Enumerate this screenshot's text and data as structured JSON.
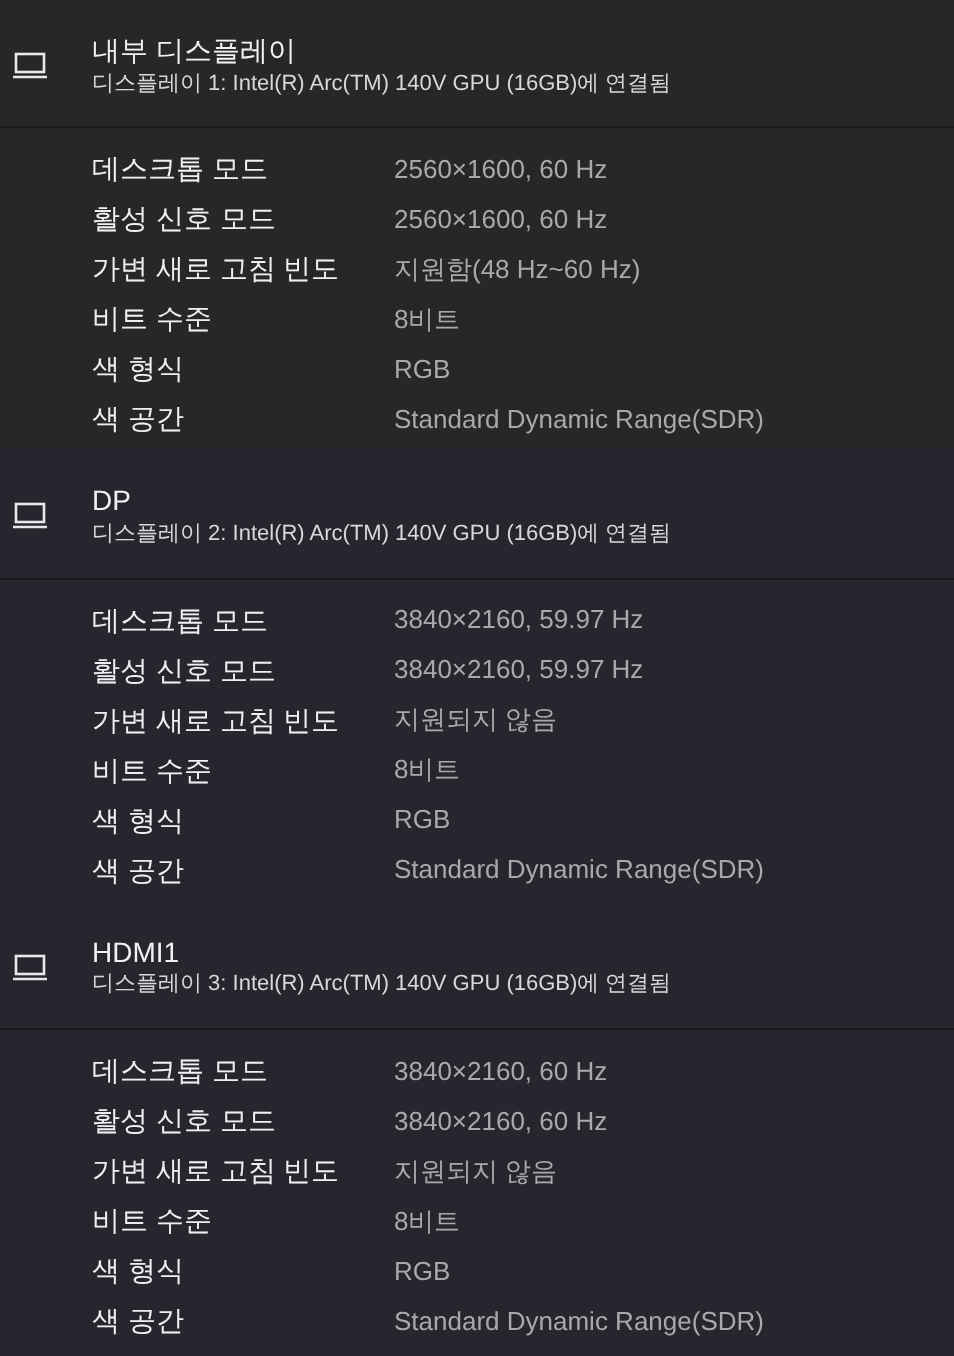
{
  "displays": [
    {
      "name": "내부 디스플레이",
      "connection": "디스플레이 1: Intel(R) Arc(TM) 140V GPU (16GB)에 연결됨",
      "properties": [
        {
          "label": "데스크톱 모드",
          "value": "2560×1600, 60 Hz"
        },
        {
          "label": "활성 신호 모드",
          "value": "2560×1600, 60 Hz"
        },
        {
          "label": "가변 새로 고침 빈도",
          "value": "지원함(48 Hz~60 Hz)"
        },
        {
          "label": "비트 수준",
          "value": "8비트"
        },
        {
          "label": "색 형식",
          "value": "RGB"
        },
        {
          "label": "색 공간",
          "value": "Standard Dynamic Range(SDR)"
        }
      ]
    },
    {
      "name": "DP",
      "connection": "디스플레이 2: Intel(R) Arc(TM) 140V GPU (16GB)에 연결됨",
      "properties": [
        {
          "label": "데스크톱 모드",
          "value": "3840×2160, 59.97 Hz"
        },
        {
          "label": "활성 신호 모드",
          "value": "3840×2160, 59.97 Hz"
        },
        {
          "label": "가변 새로 고침 빈도",
          "value": "지원되지 않음"
        },
        {
          "label": "비트 수준",
          "value": "8비트"
        },
        {
          "label": "색 형식",
          "value": "RGB"
        },
        {
          "label": "색 공간",
          "value": "Standard Dynamic Range(SDR)"
        }
      ]
    },
    {
      "name": "HDMI1",
      "connection": "디스플레이 3: Intel(R) Arc(TM) 140V GPU (16GB)에 연결됨",
      "properties": [
        {
          "label": "데스크톱 모드",
          "value": "3840×2160, 60 Hz"
        },
        {
          "label": "활성 신호 모드",
          "value": "3840×2160, 60 Hz"
        },
        {
          "label": "가변 새로 고침 빈도",
          "value": "지원되지 않음"
        },
        {
          "label": "비트 수준",
          "value": "8비트"
        },
        {
          "label": "색 형식",
          "value": "RGB"
        },
        {
          "label": "색 공간",
          "value": "Standard Dynamic Range(SDR)"
        }
      ]
    }
  ]
}
